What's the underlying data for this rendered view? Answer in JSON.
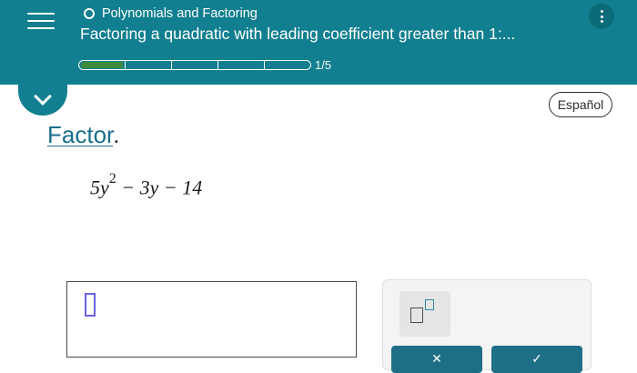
{
  "header": {
    "topic": "Polynomials and Factoring",
    "lesson_title": "Factoring a quadratic with leading coefficient greater than 1:...",
    "progress_text": "1/5",
    "progress": {
      "current": 1,
      "total": 5
    },
    "menu_icon": "hamburger-menu-icon",
    "options_icon": "vertical-ellipsis-icon",
    "background_color": "#117f8f"
  },
  "controls": {
    "language_button": "Español",
    "collapse_icon": "chevron-down-icon"
  },
  "problem": {
    "instruction_link": "Factor",
    "instruction_period": ".",
    "expression_coefficient": "5y",
    "expression_exponent": "2",
    "expression_rest": " − 3y − 14"
  },
  "answer": {
    "value": ""
  },
  "tools": {
    "exponent_icon": "exponent-template-icon",
    "clear_icon": "x-icon",
    "check_icon": "check-icon"
  }
}
